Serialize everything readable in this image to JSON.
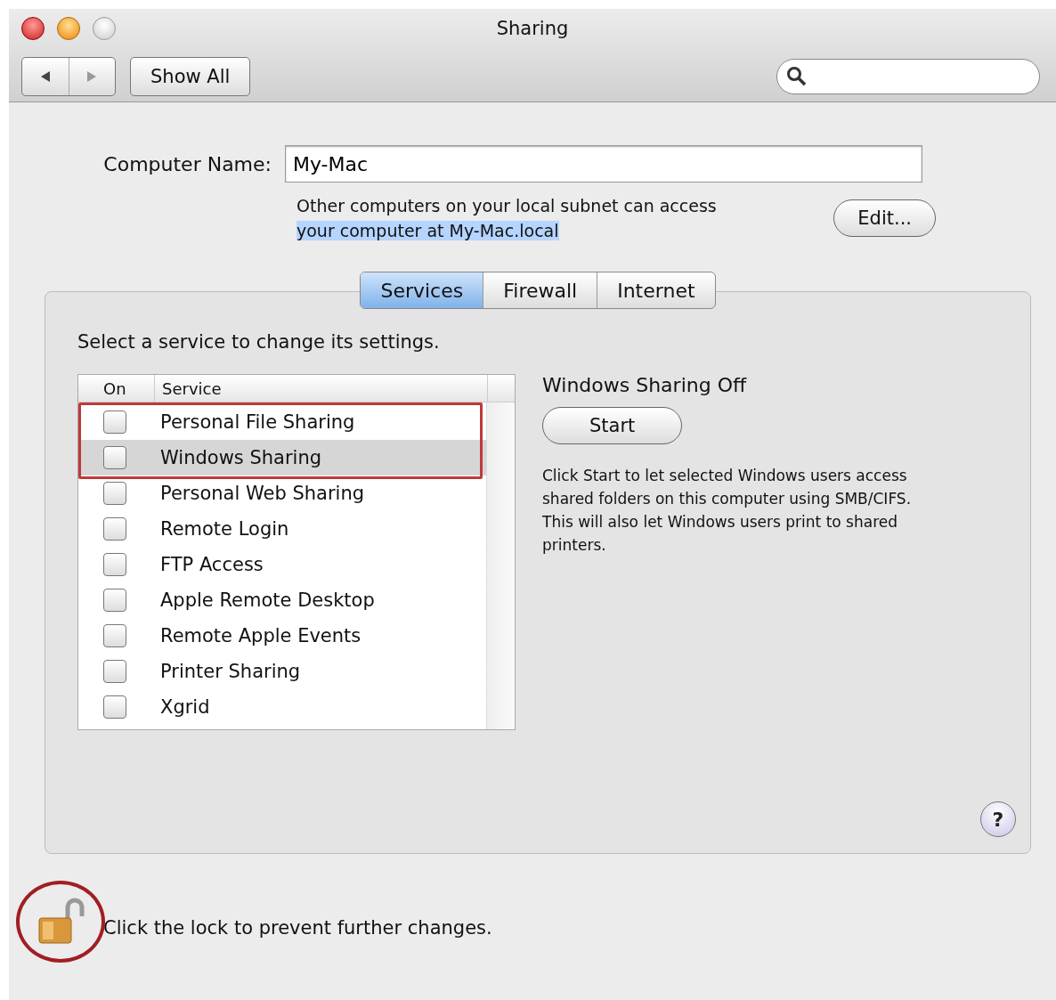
{
  "window": {
    "title": "Sharing"
  },
  "toolbar": {
    "show_all": "Show All"
  },
  "computer_name": {
    "label": "Computer Name:",
    "value": "My-Mac"
  },
  "address_note": {
    "text": "Other computers on your local subnet can access",
    "link": "your computer at My-Mac.local",
    "link_selected": true
  },
  "edit_button": "Edit...",
  "tabs": [
    {
      "label": "Services",
      "selected": true
    },
    {
      "label": "Firewall",
      "selected": false
    },
    {
      "label": "Internet",
      "selected": false
    }
  ],
  "instruction": "Select a service to change its settings.",
  "table": {
    "columns": [
      "On",
      "Service"
    ],
    "rows": [
      {
        "service": "Personal File Sharing",
        "checked": false,
        "selected": false,
        "highlighted": true
      },
      {
        "service": "Windows Sharing",
        "checked": false,
        "selected": true,
        "highlighted": true
      },
      {
        "service": "Personal Web Sharing",
        "checked": false,
        "selected": false,
        "highlighted": false
      },
      {
        "service": "Remote Login",
        "checked": false,
        "selected": false,
        "highlighted": false
      },
      {
        "service": "FTP Access",
        "checked": false,
        "selected": false,
        "highlighted": false
      },
      {
        "service": "Apple Remote Desktop",
        "checked": false,
        "selected": false,
        "highlighted": false
      },
      {
        "service": "Remote Apple Events",
        "checked": false,
        "selected": false,
        "highlighted": false
      },
      {
        "service": "Printer Sharing",
        "checked": false,
        "selected": false,
        "highlighted": false
      },
      {
        "service": "Xgrid",
        "checked": false,
        "selected": false,
        "highlighted": false
      }
    ]
  },
  "detail": {
    "status": "Windows Sharing Off",
    "button": "Start",
    "description": "Click Start to let selected Windows users access shared folders on this computer using SMB/CIFS. This will also let Windows users print to shared printers."
  },
  "help_button": "?",
  "footer": {
    "locked": false,
    "lock_highlighted": true,
    "text": "Click the lock to prevent further changes."
  }
}
